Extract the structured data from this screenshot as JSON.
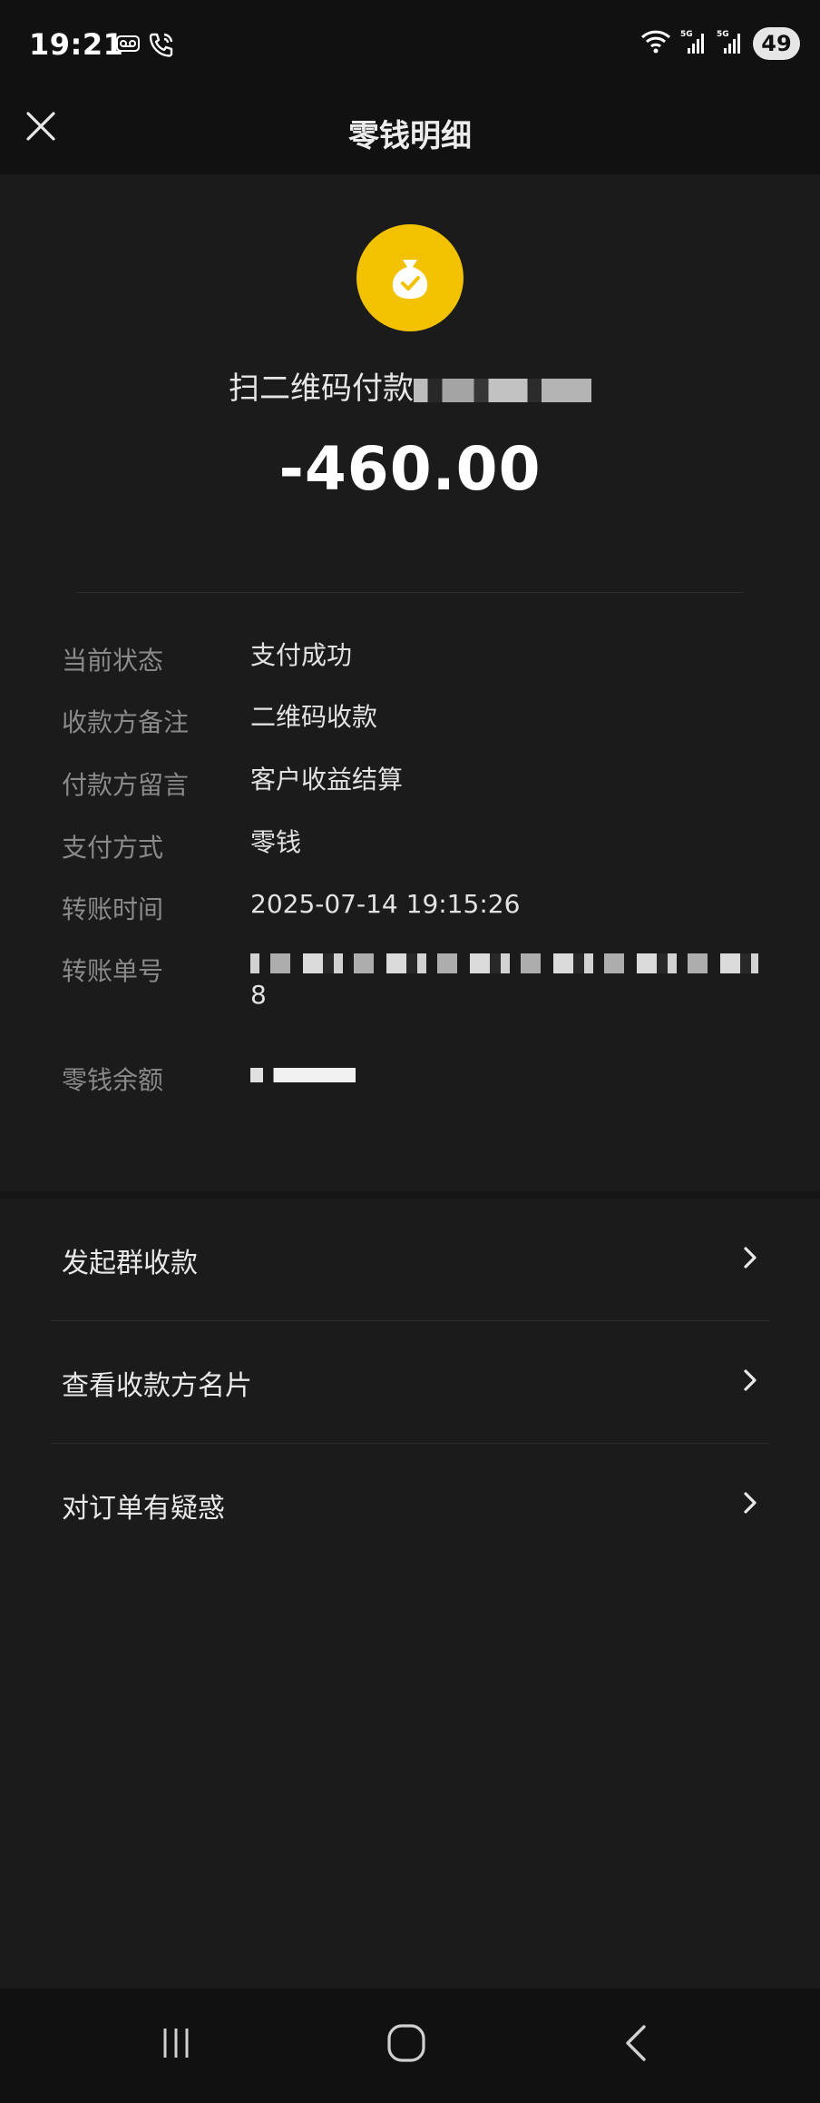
{
  "status_bar": {
    "time": "19:21",
    "battery": "49",
    "icons": [
      "voicemail-icon",
      "wifi-call-icon",
      "wifi-icon",
      "signal-5g-icon",
      "signal-5g-icon"
    ]
  },
  "header": {
    "title": "零钱明细",
    "close_icon": "close-icon"
  },
  "transaction": {
    "icon": "money-bag-check-icon",
    "merchant_prefix": "扫二维码付款",
    "amount": "-460.00",
    "accent_color": "#f2c200"
  },
  "details": [
    {
      "label": "当前状态",
      "value": "支付成功"
    },
    {
      "label": "收款方备注",
      "value": "二维码收款"
    },
    {
      "label": "付款方留言",
      "value": "客户收益结算"
    },
    {
      "label": "支付方式",
      "value": "零钱"
    },
    {
      "label": "转账时间",
      "value": "2025-07-14 19:15:26"
    },
    {
      "label": "转账单号",
      "value": "8"
    },
    {
      "label": "零钱余额",
      "value": ""
    }
  ],
  "actions": [
    {
      "label": "发起群收款"
    },
    {
      "label": "查看收款方名片"
    },
    {
      "label": "对订单有疑惑"
    }
  ],
  "nav_bar": {
    "icons": [
      "recent-apps-icon",
      "home-icon",
      "back-icon"
    ]
  }
}
